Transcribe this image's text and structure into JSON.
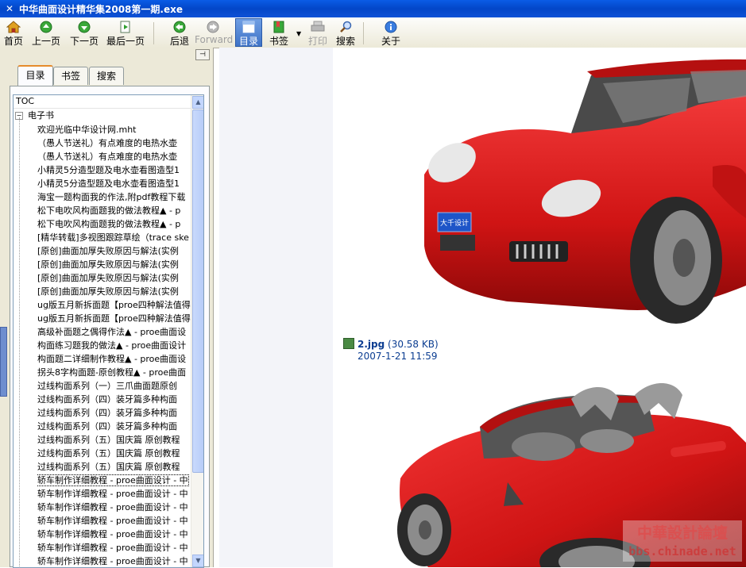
{
  "window": {
    "title": "中华曲面设计精华集2008第一期.exe"
  },
  "toolbar": {
    "buttons": [
      {
        "label": "首页",
        "icon": "home-icon",
        "state": "enabled"
      },
      {
        "label": "上一页",
        "icon": "previous-page-icon",
        "state": "enabled"
      },
      {
        "label": "下一页",
        "icon": "next-page-icon",
        "state": "enabled"
      },
      {
        "label": "最后一页",
        "icon": "last-page-icon",
        "state": "enabled"
      },
      {
        "label": "后退",
        "icon": "back-icon",
        "state": "enabled"
      },
      {
        "label": "Forward",
        "icon": "forward-icon",
        "state": "disabled"
      },
      {
        "label": "目录",
        "icon": "contents-icon",
        "state": "active"
      },
      {
        "label": "书签",
        "icon": "bookmark-icon",
        "state": "enabled"
      },
      {
        "label": "打印",
        "icon": "print-icon",
        "state": "disabled"
      },
      {
        "label": "搜索",
        "icon": "search-icon",
        "state": "enabled"
      },
      {
        "label": "关于",
        "icon": "info-icon",
        "state": "enabled"
      }
    ]
  },
  "sidebar": {
    "tabs": [
      {
        "label": "目录",
        "active": true
      },
      {
        "label": "书签",
        "active": false
      },
      {
        "label": "搜索",
        "active": false
      }
    ],
    "tree_header": "TOC",
    "root_label": "电子书",
    "items": [
      "欢迎光临中华设计网.mht",
      "（愚人节送礼）有点难度的电热水壶",
      "（愚人节送礼）有点难度的电热水壶",
      "小精灵5分造型题及电水壶看图造型1",
      "小精灵5分造型题及电水壶看图造型1",
      "海宝一题构面我的作法,附pdf教程下载",
      "松下电吹风构面题我的做法教程▲ - p",
      "松下电吹风构面题我的做法教程▲ - p",
      "[精华转载]多视图跟踪草绘（trace ske",
      "[原创]曲面加厚失败原因与解法(实例",
      "[原创]曲面加厚失败原因与解法(实例",
      "[原创]曲面加厚失败原因与解法(实例",
      "[原创]曲面加厚失败原因与解法(实例",
      "ug版五月新拆面题【proe四种解法值得",
      "ug版五月新拆面题【proe四种解法值得",
      "高级补面题之偶得作法▲ - proe曲面设",
      "构面练习题我的做法▲ - proe曲面设计",
      "构面题二详细制作教程▲ - proe曲面设",
      "拐头8字构面题-原创教程▲ - proe曲面",
      "过线构面系列（一）三爪曲面题原创",
      "过线构面系列（四）装牙篇多种构面",
      "过线构面系列（四）装牙篇多种构面",
      "过线构面系列（四）装牙篇多种构面",
      "过线构面系列（五）国庆篇 原创教程",
      "过线构面系列（五）国庆篇 原创教程",
      "过线构面系列（五）国庆篇 原创教程",
      "轿车制作详细教程 - proe曲面设计 - 中",
      "轿车制作详细教程 - proe曲面设计 - 中",
      "轿车制作详细教程 - proe曲面设计 - 中",
      "轿车制作详细教程 - proe曲面设计 - 中",
      "轿车制作详细教程 - proe曲面设计 - 中",
      "轿车制作详细教程 - proe曲面设计 - 中",
      "轿车制作详细教程 - proe曲面设计 - 中"
    ],
    "selected_index": 26
  },
  "content": {
    "file": {
      "name": "2.jpg",
      "size": "(30.58 KB)",
      "date": "2007-1-21 11:59"
    },
    "plate_text": "大千设计",
    "watermark": {
      "line1": "中華設計論壇",
      "line2": "bbs.chinade.net"
    }
  },
  "colors": {
    "car_red": "#d81a1a",
    "titlebar_blue": "#0a5ce6",
    "link_blue": "#0b3d91"
  }
}
